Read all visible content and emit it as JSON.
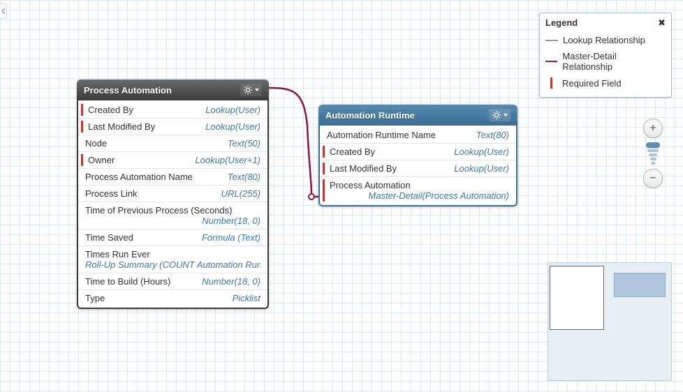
{
  "canvas": {
    "collapsed_panel_icon": "chevron-left"
  },
  "nodes": {
    "process_automation": {
      "title": "Process Automation",
      "fields": {
        "created_by": {
          "label": "Created By",
          "type": "Lookup(User)",
          "required": true
        },
        "last_modified_by": {
          "label": "Last Modified By",
          "type": "Lookup(User)",
          "required": true
        },
        "node": {
          "label": "Node",
          "type": "Text(50)",
          "required": false
        },
        "owner": {
          "label": "Owner",
          "type": "Lookup(User+1)",
          "required": true
        },
        "name": {
          "label": "Process Automation Name",
          "type": "Text(80)",
          "required": false
        },
        "process_link": {
          "label": "Process Link",
          "type": "URL(255)",
          "required": false
        },
        "time_prev": {
          "label": "Time of Previous Process (Seconds)",
          "type": "Number(18, 0)",
          "required": false
        },
        "time_saved": {
          "label": "Time Saved",
          "type": "Formula (Text)",
          "required": false
        },
        "times_run": {
          "label": "Times Run Ever",
          "type": "Roll-Up Summary (COUNT Automation Runtime)",
          "required": false
        },
        "time_build": {
          "label": "Time to Build (Hours)",
          "type": "Number(18, 0)",
          "required": false
        },
        "type": {
          "label": "Type",
          "type": "Picklist",
          "required": false
        }
      }
    },
    "automation_runtime": {
      "title": "Automation Runtime",
      "fields": {
        "name": {
          "label": "Automation Runtime Name",
          "type": "Text(80)",
          "required": false
        },
        "created_by": {
          "label": "Created By",
          "type": "Lookup(User)",
          "required": true
        },
        "last_modified_by": {
          "label": "Last Modified By",
          "type": "Lookup(User)",
          "required": true
        },
        "process_automation": {
          "label": "Process Automation",
          "type": "Master-Detail(Process Automation)",
          "required": true
        }
      }
    }
  },
  "connector": {
    "kind": "master-detail",
    "from": "process_automation",
    "to": "automation_runtime"
  },
  "legend": {
    "title": "Legend",
    "lookup": "Lookup Relationship",
    "master": "Master-Detail Relationship",
    "required": "Required Field"
  },
  "zoom": {
    "in_label": "+",
    "out_label": "−"
  }
}
